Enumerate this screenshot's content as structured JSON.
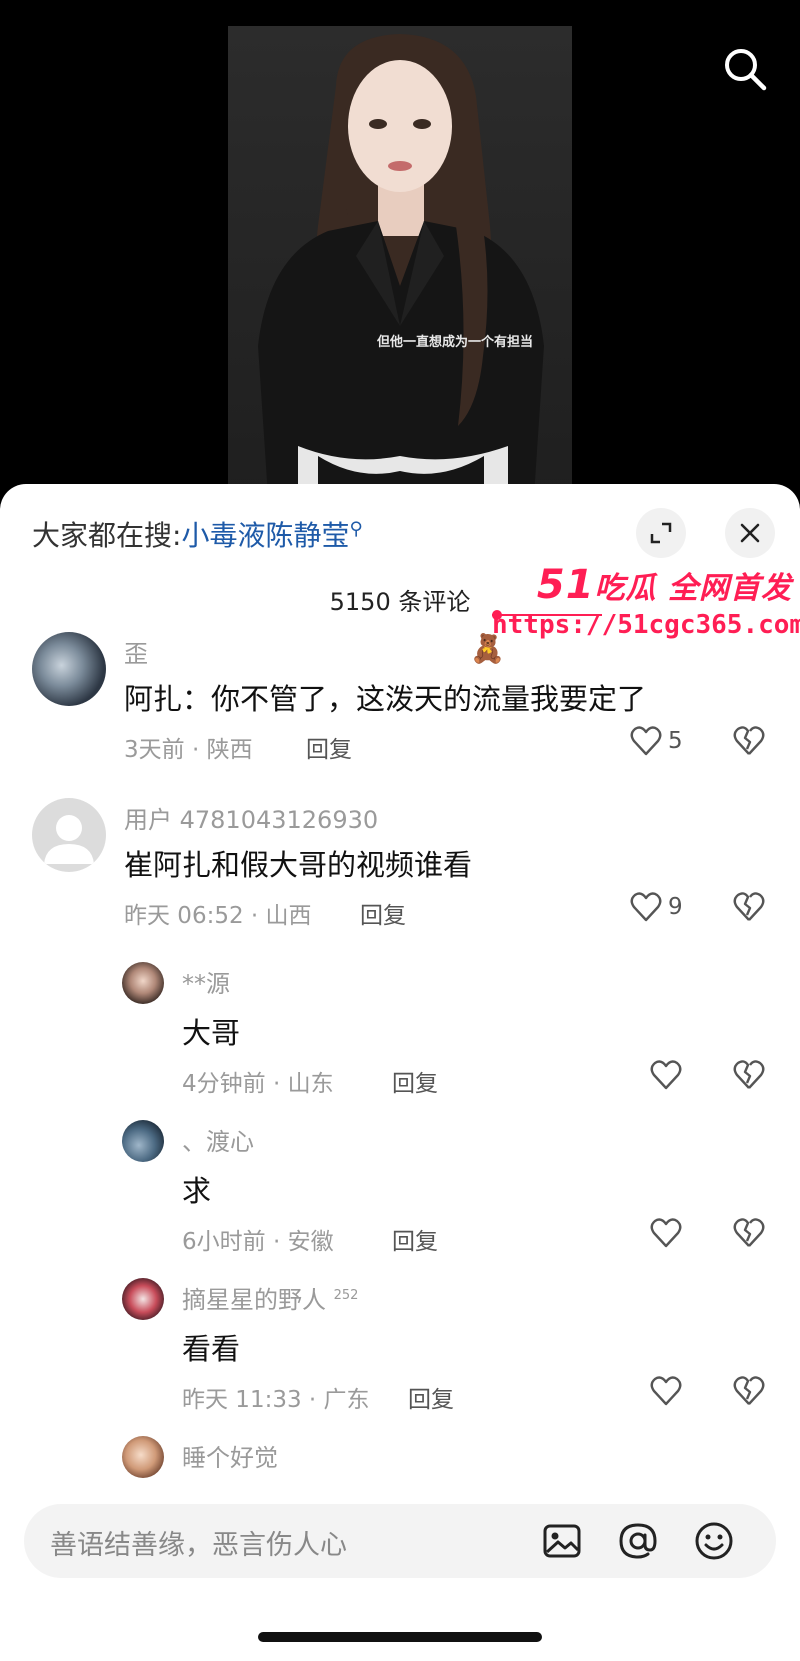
{
  "video": {
    "caption": "但他一直想成为一个有担当"
  },
  "header": {
    "hot_search_prefix": "大家都在搜:",
    "hot_search_term": "小毒液陈静莹",
    "comment_count": "5150 条评论"
  },
  "watermark": {
    "brand_num": "51",
    "brand_text": "吃瓜 全网首发",
    "url": "https://51cgc365.com"
  },
  "comments": [
    {
      "username": "歪",
      "text": "阿扎：你不管了，这泼天的流量我要定了",
      "time": "3天前 · 陕西",
      "reply": "回复",
      "likes": "5",
      "sticker": "🧸"
    },
    {
      "username": "用户 4781043126930",
      "text": "崔阿扎和假大哥的视频谁看",
      "time": "昨天 06:52 · 山西",
      "reply": "回复",
      "likes": "9"
    }
  ],
  "replies": [
    {
      "username": "**源",
      "text": "大哥",
      "time": "4分钟前 · 山东",
      "reply": "回复"
    },
    {
      "username": "、渡心",
      "text": "求",
      "time": "6小时前 · 安徽",
      "reply": "回复"
    },
    {
      "username": "摘星星的野人",
      "badge": "252",
      "text": "看看",
      "time": "昨天 11:33 · 广东",
      "reply": "回复"
    },
    {
      "username": "睡个好觉"
    }
  ],
  "input": {
    "placeholder": "善语结善缘，恶言伤人心"
  }
}
